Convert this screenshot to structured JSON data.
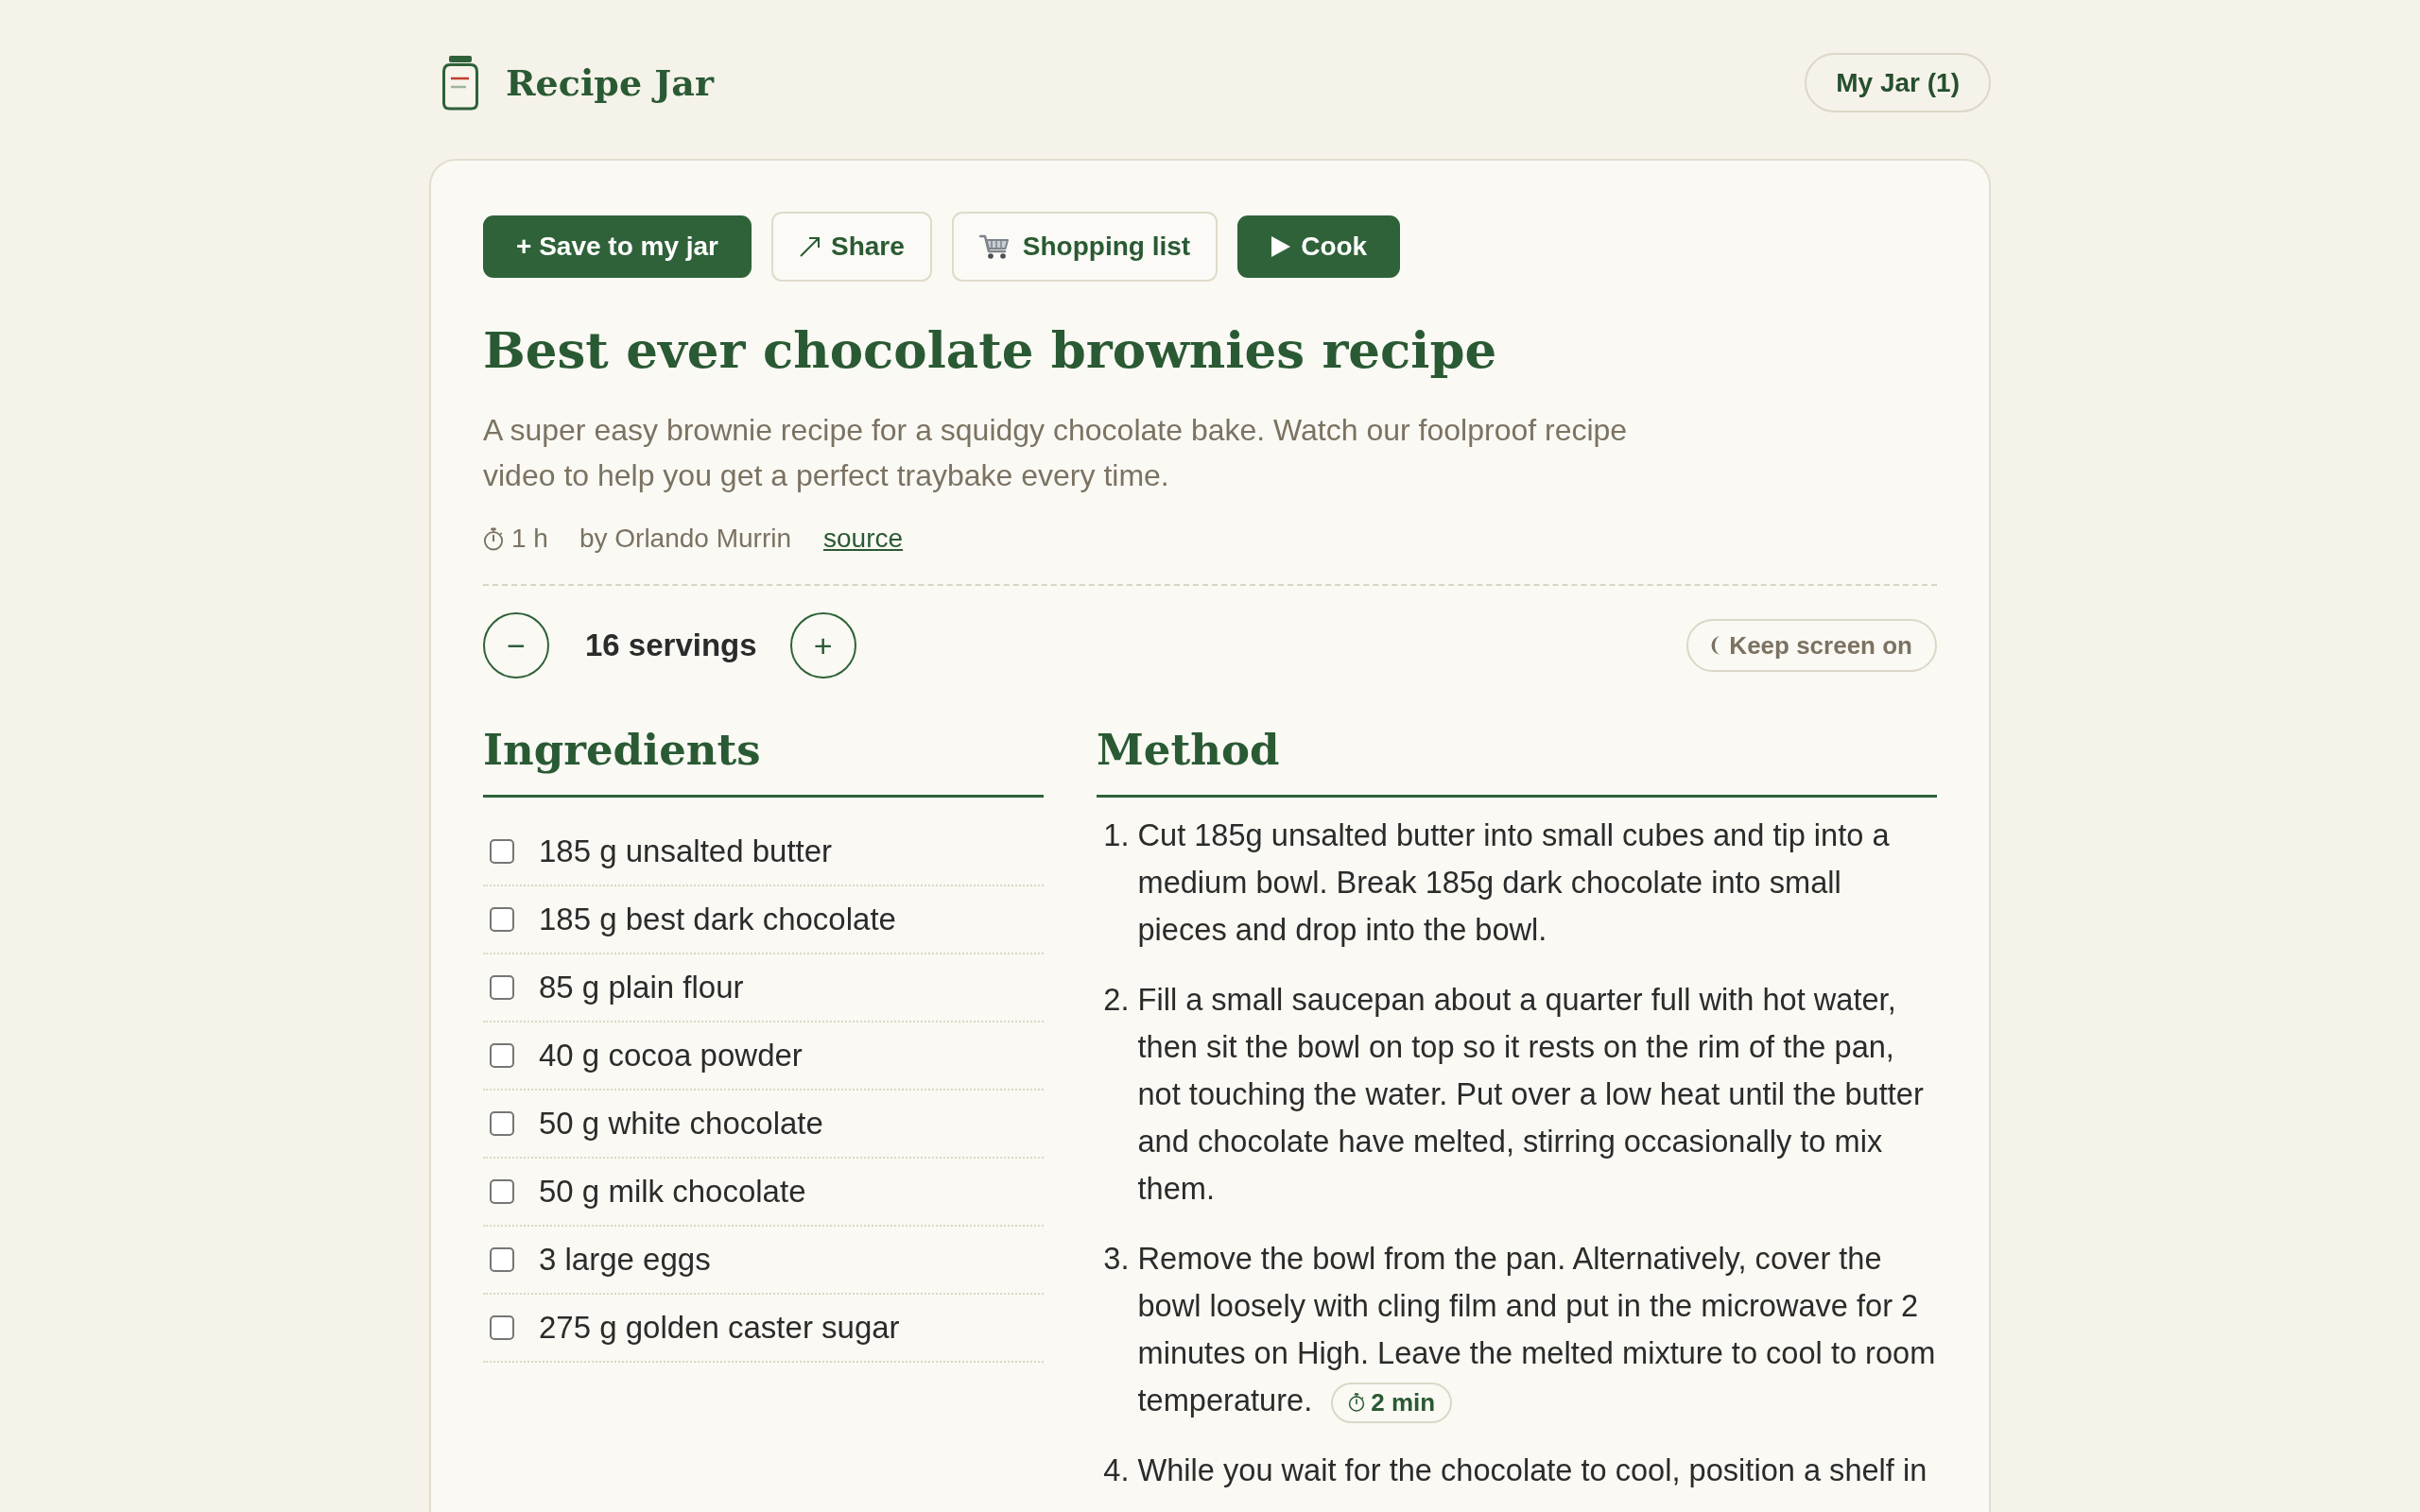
{
  "header": {
    "title": "Recipe Jar",
    "jar_button": "My Jar (1)"
  },
  "actions": [
    {
      "kind": "save",
      "label": "+ Save to my jar"
    },
    {
      "kind": "share",
      "label": "Share"
    },
    {
      "kind": "shopping",
      "label": "Shopping list"
    },
    {
      "kind": "cook",
      "label": "Cook"
    }
  ],
  "recipe": {
    "title": "Best ever chocolate brownies recipe",
    "description": "A super easy brownie recipe for a squidgy chocolate bake. Watch our foolproof recipe video to help you get a perfect traybake every time.",
    "time": "1 h",
    "author": "by Orlando Murrin",
    "source_link": "source"
  },
  "servings": {
    "decrease": "−",
    "count": "16 servings",
    "increase": "+",
    "keep_screen_on": {
      "label": "Keep screen on",
      "on": false
    }
  },
  "ingredients": {
    "heading": "Ingredients",
    "items": [
      {
        "text": "185 g unsalted butter",
        "checked": false
      },
      {
        "text": "185 g best dark chocolate",
        "checked": false
      },
      {
        "text": "85 g plain flour",
        "checked": false
      },
      {
        "text": "40 g cocoa powder",
        "checked": false
      },
      {
        "text": "50 g white chocolate",
        "checked": false
      },
      {
        "text": "50 g milk chocolate",
        "checked": false
      },
      {
        "text": "3 large eggs",
        "checked": false
      },
      {
        "text": "275 g golden caster sugar",
        "checked": false
      }
    ]
  },
  "method": {
    "heading": "Method",
    "steps": [
      {
        "number": "1.",
        "text": "Cut 185g unsalted butter into small cubes and tip into a medium bowl. Break 185g dark chocolate into small pieces and drop into the bowl."
      },
      {
        "number": "2.",
        "text": "Fill a small saucepan about a quarter full with hot water, then sit the bowl on top so it rests on the rim of the pan, not touching the water. Put over a low heat until the butter and chocolate have melted, stirring occasionally to mix them."
      },
      {
        "number": "3.",
        "text": "Remove the bowl from the pan. Alternatively, cover the bowl loosely with cling film and put in the microwave for 2 minutes on High. Leave the melted mixture to cool to room temperature.",
        "timer": "2 min"
      },
      {
        "number": "4.",
        "text": "While you wait for the chocolate to cool, position a shelf in"
      }
    ]
  }
}
